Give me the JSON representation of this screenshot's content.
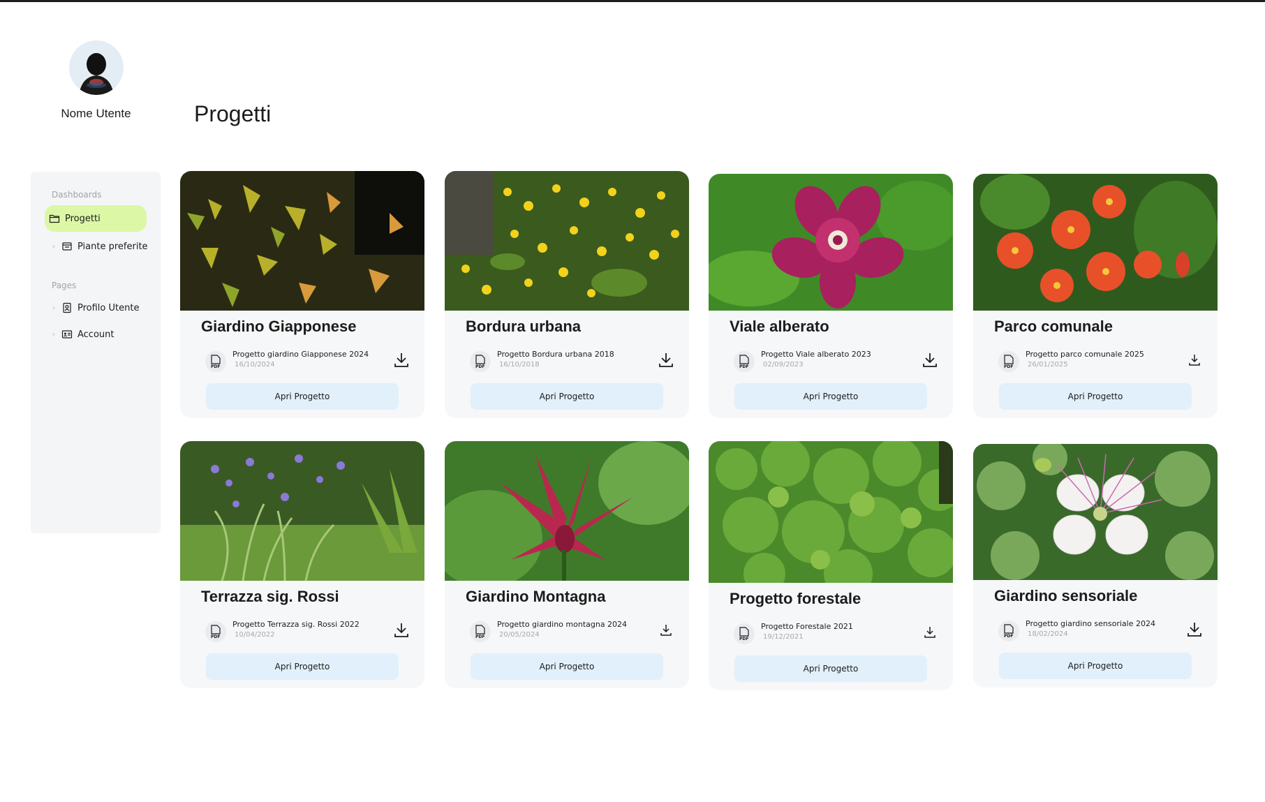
{
  "user": {
    "name": "Nome Utente"
  },
  "page": {
    "title": "Progetti"
  },
  "sidebar": {
    "dashboards_label": "Dashboards",
    "pages_label": "Pages",
    "items": [
      {
        "label": "Progetti",
        "icon": "folder-icon",
        "active": true
      },
      {
        "label": "Piante preferite",
        "icon": "inbox-icon",
        "active": false
      },
      {
        "label": "Profilo Utente",
        "icon": "id-badge-icon",
        "active": false
      },
      {
        "label": "Account",
        "icon": "id-card-icon",
        "active": false
      }
    ],
    "active_color": "#dcf7a6"
  },
  "cards": [
    {
      "title": "Giardino Giapponese",
      "file_name": "Progetto giardino Giapponese 2024",
      "file_date": "16/10/2024",
      "button": "Apri Progetto",
      "image": "japanese-maple-leaves"
    },
    {
      "title": "Bordura urbana",
      "file_name": "Progetto Bordura urbana 2018",
      "file_date": "16/10/2018",
      "button": "Apri Progetto",
      "image": "yellow-flowers-shrub"
    },
    {
      "title": "Viale alberato",
      "file_name": "Progetto Viale alberato  2023",
      "file_date": "02/09/2023",
      "button": "Apri Progetto",
      "image": "magenta-flower"
    },
    {
      "title": "Parco comunale",
      "file_name": "Progetto parco comunale 2025",
      "file_date": "26/01/2025",
      "button": "Apri Progetto",
      "image": "orange-trumpet-flowers"
    },
    {
      "title": "Terrazza sig. Rossi",
      "file_name": "Progetto Terrazza sig. Rossi 2022",
      "file_date": "10/04/2022",
      "button": "Apri Progetto",
      "image": "purple-flowers-ferns"
    },
    {
      "title": "Giardino Montagna",
      "file_name": "Progetto giardino montagna 2024",
      "file_date": "20/05/2024",
      "button": "Apri Progetto",
      "image": "red-star-flower"
    },
    {
      "title": "Progetto forestale",
      "file_name": "Progetto Forestale 2021",
      "file_date": "19/12/2021",
      "button": "Apri Progetto",
      "image": "green-shrub"
    },
    {
      "title": "Giardino sensoriale",
      "file_name": "Progetto giardino sensoriale 2024",
      "file_date": "18/02/2024",
      "button": "Apri Progetto",
      "image": "white-caper-flower"
    }
  ],
  "icons": {
    "file": "pdf-icon",
    "download": "download-icon"
  },
  "colors": {
    "button_bg": "#e1f0fb",
    "card_bg": "#f6f7f9",
    "sidebar_bg": "#f4f5f7"
  }
}
